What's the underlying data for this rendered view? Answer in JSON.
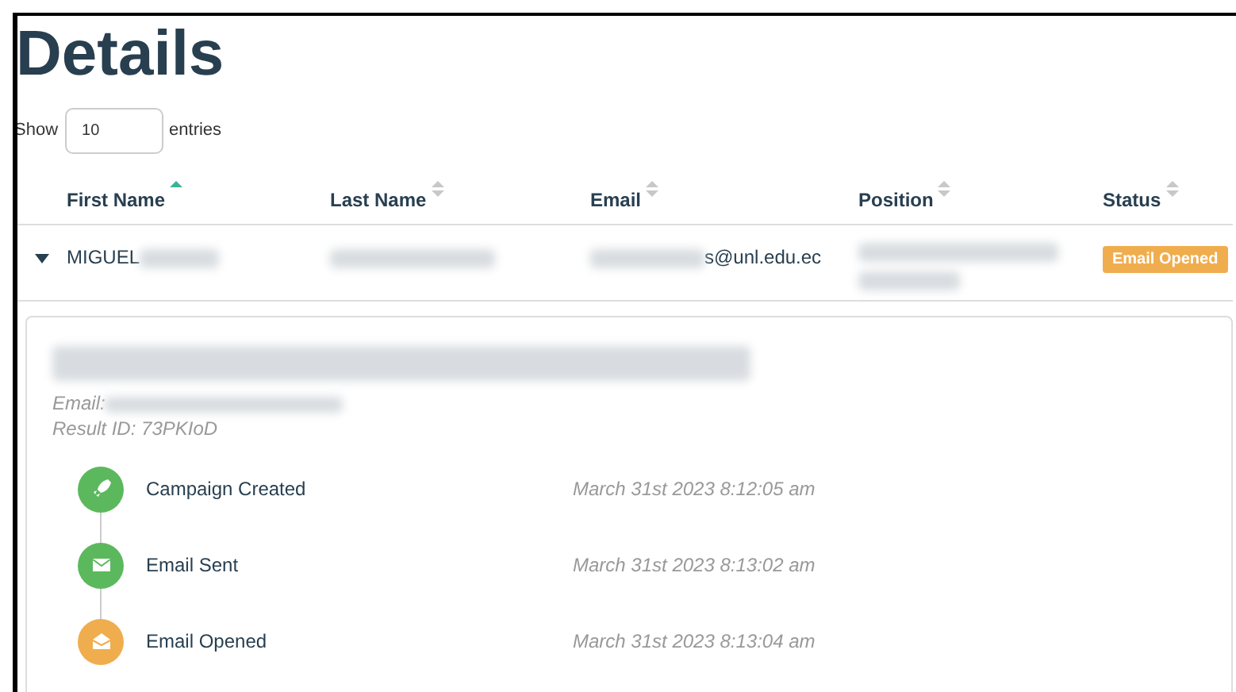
{
  "heading": "Details",
  "length_control": {
    "label_before": "Show",
    "value": "10",
    "label_after": "entries"
  },
  "table": {
    "columns": [
      {
        "label": "First Name",
        "sorted": true
      },
      {
        "label": "Last Name",
        "sorted": false
      },
      {
        "label": "Email",
        "sorted": false
      },
      {
        "label": "Position",
        "sorted": false
      },
      {
        "label": "Status",
        "sorted": false
      }
    ],
    "rows": [
      {
        "expanded": true,
        "first_name": "MIGUEL",
        "email_tail": "s@unl.edu.ec",
        "status": {
          "label": "Email Opened",
          "color": "#f0ad4e"
        }
      }
    ]
  },
  "timeline": {
    "email_label": "Email:",
    "result_id": "Result ID: 73PKIoD",
    "events": [
      {
        "kind": "rocket",
        "label": "Campaign Created",
        "time": "March 31st 2023 8:12:05 am",
        "color": "#5cb85c"
      },
      {
        "kind": "envelope",
        "label": "Email Sent",
        "time": "March 31st 2023 8:13:02 am",
        "color": "#5cb85c"
      },
      {
        "kind": "envelope-open",
        "label": "Email Opened",
        "time": "March 31st 2023 8:13:04 am",
        "color": "#f0ad4e"
      }
    ]
  }
}
